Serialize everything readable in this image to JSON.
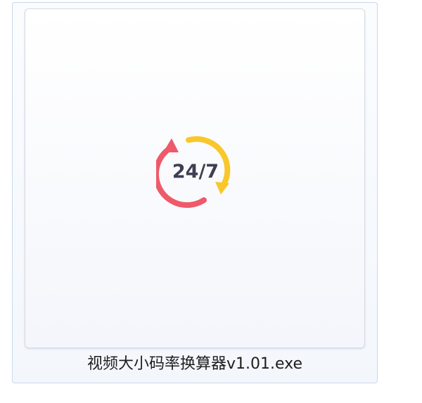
{
  "file": {
    "name": "视频大小码率换算器v1.01.exe",
    "icon": "clock-24-7-icon",
    "icon_text": "24/7"
  },
  "colors": {
    "tile_border": "#c9d9ec",
    "tile_background": "#f3f7fc",
    "arc_red": "#ee5a6a",
    "arc_yellow": "#f9c72a",
    "icon_text": "#3f3f52"
  }
}
